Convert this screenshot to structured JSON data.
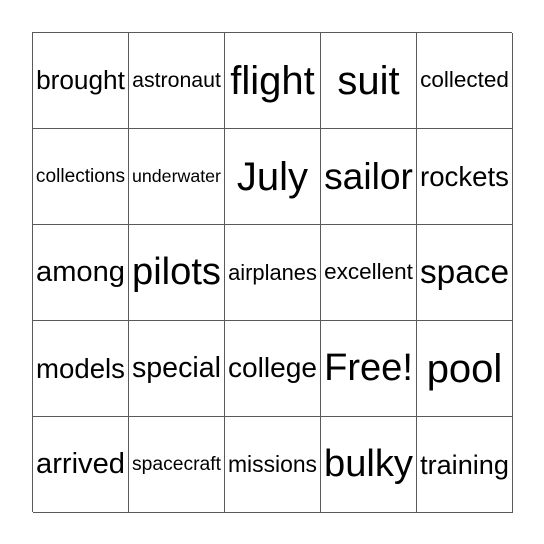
{
  "card": {
    "rows": [
      [
        "brought",
        "astronaut",
        "flight",
        "suit",
        "collected"
      ],
      [
        "collections",
        "underwater",
        "July",
        "sailor",
        "rockets"
      ],
      [
        "among",
        "pilots",
        "airplanes",
        "excellent",
        "space"
      ],
      [
        "models",
        "special",
        "college",
        "Free!",
        "pool"
      ],
      [
        "arrived",
        "spacecraft",
        "missions",
        "bulky",
        "training"
      ]
    ],
    "free_space": "Free!"
  },
  "colors": {
    "grid_line": "#5a5a5a",
    "text": "#000000",
    "background": "#ffffff"
  }
}
